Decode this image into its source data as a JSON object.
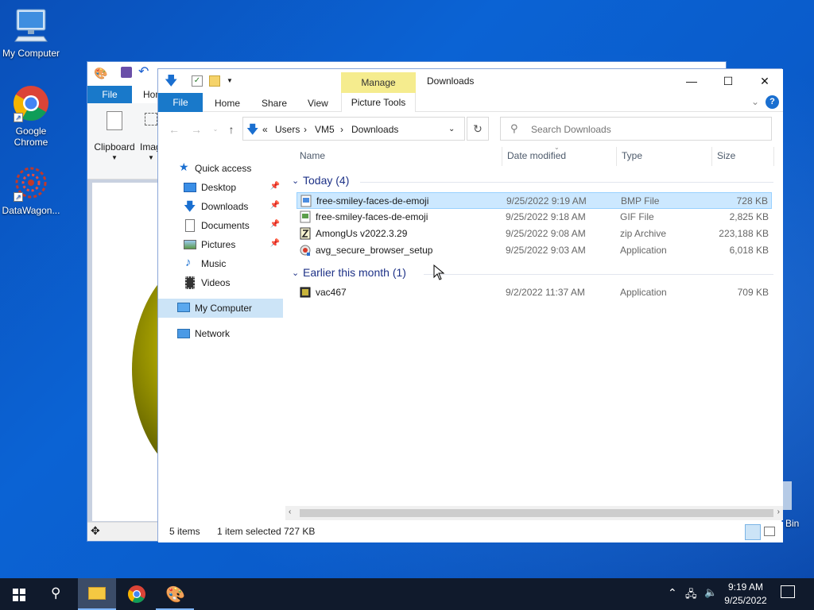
{
  "desktop": {
    "icons": [
      {
        "label": "My Computer"
      },
      {
        "label": "Google Chrome"
      },
      {
        "label": "DataWagon..."
      }
    ],
    "recycle_bin_partial": "Bin"
  },
  "paint_window": {
    "file_tab": "File",
    "home_tab": "Hor",
    "groups": [
      "Clipboard",
      "Imag"
    ]
  },
  "explorer": {
    "title": "Downloads",
    "manage_tab": "Manage",
    "ribbon_tabs": {
      "file": "File",
      "home": "Home",
      "share": "Share",
      "view": "View",
      "picture_tools": "Picture Tools"
    },
    "address": {
      "overflow": "«",
      "crumbs": [
        "Users",
        "VM5",
        "Downloads"
      ]
    },
    "search": {
      "placeholder": "Search Downloads"
    },
    "nav": [
      {
        "label": "Quick access"
      },
      {
        "label": "Desktop",
        "pinned": true
      },
      {
        "label": "Downloads",
        "pinned": true
      },
      {
        "label": "Documents",
        "pinned": true
      },
      {
        "label": "Pictures",
        "pinned": true
      },
      {
        "label": "Music"
      },
      {
        "label": "Videos"
      },
      {
        "label": "My Computer",
        "selected": true
      },
      {
        "label": "Network"
      }
    ],
    "columns": {
      "name": "Name",
      "date": "Date modified",
      "type": "Type",
      "size": "Size"
    },
    "groups": [
      {
        "label": "Today (4)",
        "files": [
          {
            "name": "free-smiley-faces-de-emoji",
            "date": "9/25/2022 9:19 AM",
            "type": "BMP File",
            "size": "728 KB",
            "selected": true
          },
          {
            "name": "free-smiley-faces-de-emoji",
            "date": "9/25/2022 9:18 AM",
            "type": "GIF File",
            "size": "2,825 KB"
          },
          {
            "name": "AmongUs v2022.3.29",
            "date": "9/25/2022 9:08 AM",
            "type": "zip Archive",
            "size": "223,188 KB"
          },
          {
            "name": "avg_secure_browser_setup",
            "date": "9/25/2022 9:03 AM",
            "type": "Application",
            "size": "6,018 KB"
          }
        ]
      },
      {
        "label": "Earlier this month (1)",
        "files": [
          {
            "name": "vac467",
            "date": "9/2/2022 11:37 AM",
            "type": "Application",
            "size": "709 KB"
          }
        ]
      }
    ],
    "status": {
      "count": "5 items",
      "selected": "1 item selected",
      "size": "727 KB"
    }
  },
  "taskbar": {
    "time": "9:19 AM",
    "date": "9/25/2022"
  },
  "colors": {
    "accent": "#1979ca",
    "selection": "#cce8ff",
    "manage": "#f5ec8e",
    "taskbar": "#101a2c"
  }
}
